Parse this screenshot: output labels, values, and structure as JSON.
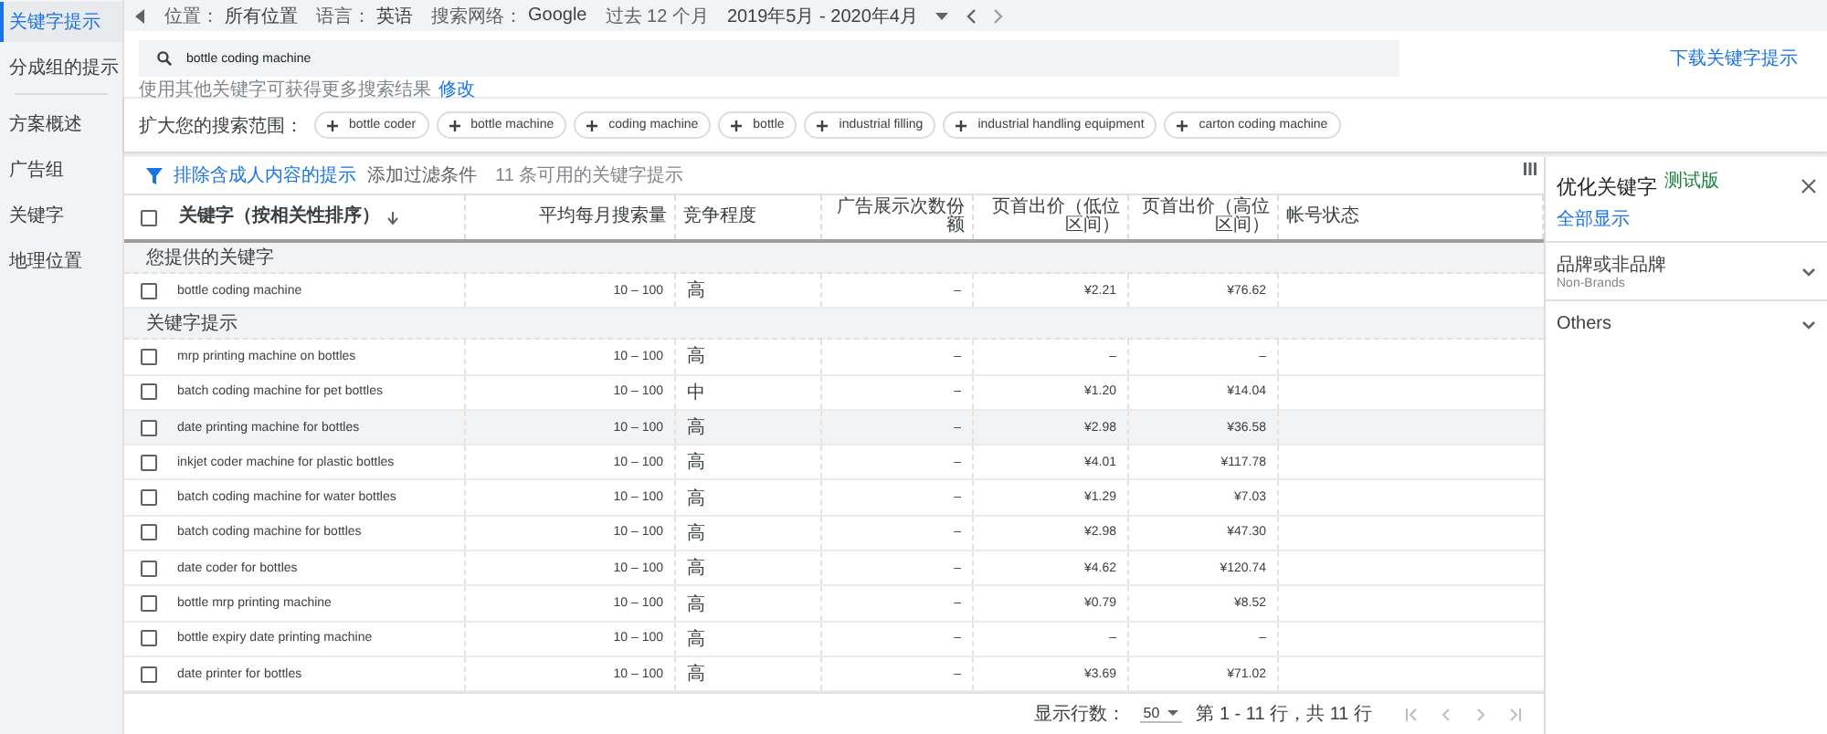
{
  "sidebar": {
    "items": [
      {
        "label": "关键字提示",
        "selected": true
      },
      {
        "label": "分成组的提示",
        "selected": false
      },
      {
        "label": "方案概述",
        "selected": false
      },
      {
        "label": "广告组",
        "selected": false
      },
      {
        "label": "关键字",
        "selected": false
      },
      {
        "label": "地理位置",
        "selected": false
      }
    ]
  },
  "topbar": {
    "filters": [
      {
        "label": "位置：",
        "value": "所有位置"
      },
      {
        "label": "语言：",
        "value": "英语"
      },
      {
        "label": "搜索网络：",
        "value": "Google"
      }
    ],
    "period_label": "过去 12 个月",
    "period": "2019年5月 - 2020年4月"
  },
  "search": {
    "value": "bottle coding machine",
    "hint": "使用其他关键字可获得更多搜索结果",
    "hint_link": "修改",
    "download": "下载关键字提示"
  },
  "broaden": {
    "label": "扩大您的搜索范围：",
    "chips": [
      "bottle coder",
      "bottle machine",
      "coding machine",
      "bottle",
      "industrial filling",
      "industrial handling equipment",
      "carton coding machine"
    ]
  },
  "filter_bar": {
    "adult_filter": "排除含成人内容的提示",
    "add_filter": "添加过滤条件",
    "count": "11 条可用的关键字提示"
  },
  "table": {
    "select_all_checked": false,
    "columns": [
      "关键字（按相关性排序）",
      "平均每月搜索量",
      "竞争程度",
      "广告展示次数份额",
      "页首出价（低位区间）",
      "页首出价（高位区间）",
      "帐号状态"
    ],
    "groups": [
      {
        "title": "您提供的关键字",
        "rows": [
          {
            "checked": false,
            "highlighted": false,
            "cells": [
              "bottle coding machine",
              "10 – 100",
              "高",
              "–",
              "¥2.21",
              "¥76.62"
            ]
          }
        ]
      },
      {
        "title": "关键字提示",
        "rows": [
          {
            "checked": false,
            "highlighted": false,
            "cells": [
              "mrp printing machine on bottles",
              "10 – 100",
              "高",
              "–",
              "–",
              "–"
            ]
          },
          {
            "checked": false,
            "highlighted": false,
            "cells": [
              "batch coding machine for pet bottles",
              "10 – 100",
              "中",
              "–",
              "¥1.20",
              "¥14.04"
            ]
          },
          {
            "checked": false,
            "highlighted": true,
            "cells": [
              "date printing machine for bottles",
              "10 – 100",
              "高",
              "–",
              "¥2.98",
              "¥36.58"
            ]
          },
          {
            "checked": false,
            "highlighted": false,
            "cells": [
              "inkjet coder machine for plastic bottles",
              "10 – 100",
              "高",
              "–",
              "¥4.01",
              "¥117.78"
            ]
          },
          {
            "checked": false,
            "highlighted": false,
            "cells": [
              "batch coding machine for water bottles",
              "10 – 100",
              "高",
              "–",
              "¥1.29",
              "¥7.03"
            ]
          },
          {
            "checked": false,
            "highlighted": false,
            "cells": [
              "batch coding machine for bottles",
              "10 – 100",
              "高",
              "–",
              "¥2.98",
              "¥47.30"
            ]
          },
          {
            "checked": false,
            "highlighted": false,
            "cells": [
              "date coder for bottles",
              "10 – 100",
              "高",
              "–",
              "¥4.62",
              "¥120.74"
            ]
          },
          {
            "checked": false,
            "highlighted": false,
            "cells": [
              "bottle mrp printing machine",
              "10 – 100",
              "高",
              "–",
              "¥0.79",
              "¥8.52"
            ]
          },
          {
            "checked": false,
            "highlighted": false,
            "cells": [
              "bottle expiry date printing machine",
              "10 – 100",
              "高",
              "–",
              "–",
              "–"
            ]
          },
          {
            "checked": false,
            "highlighted": false,
            "cells": [
              "date printer for bottles",
              "10 – 100",
              "高",
              "–",
              "¥3.69",
              "¥71.02"
            ]
          }
        ]
      }
    ]
  },
  "pagination": {
    "rows_label": "显示行数：",
    "rows_value": "50",
    "range": "第 1 - 11 行，共 11 行"
  },
  "panel": {
    "title": "优化关键字",
    "badge": "测试版",
    "show_all": "全部显示",
    "sections": [
      {
        "title": "品牌或非品牌",
        "subtitle": "Non-Brands",
        "expanded": false
      },
      {
        "title": "Others",
        "expanded": false
      }
    ]
  }
}
